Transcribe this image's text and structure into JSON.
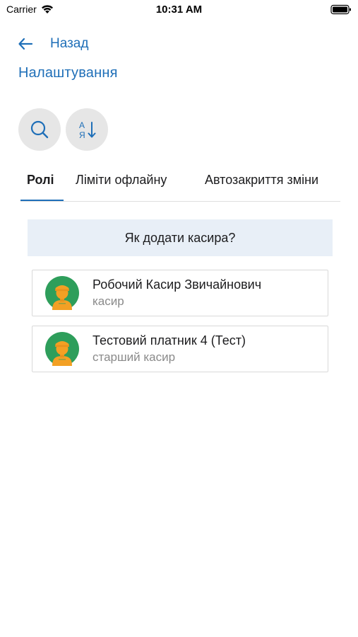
{
  "status_bar": {
    "carrier": "Carrier",
    "time": "10:31 AM"
  },
  "nav": {
    "back_label": "Назад",
    "page_title": "Налаштування"
  },
  "actions": {
    "search_icon": "search-icon",
    "sort_icon": "sort-alpha-icon",
    "sort_glyph_top": "А",
    "sort_glyph_bottom": "Я"
  },
  "tabs": [
    {
      "label": "Ролі",
      "active": true
    },
    {
      "label": "Ліміти офлайну",
      "active": false
    },
    {
      "label": "Автозакриття зміни",
      "active": false
    }
  ],
  "help_banner": {
    "text": "Як додати касира?"
  },
  "users": [
    {
      "name": "Робочий Касир Звичайнович",
      "role": "касир"
    },
    {
      "name": "Тестовий платник 4 (Тест)",
      "role": "старший касир"
    }
  ],
  "colors": {
    "accent": "#1f6fb8",
    "avatar_bg": "#2e9e5b",
    "avatar_figure": "#f3a024",
    "banner_bg": "#e8eff7",
    "button_bg": "#e6e6e6"
  }
}
